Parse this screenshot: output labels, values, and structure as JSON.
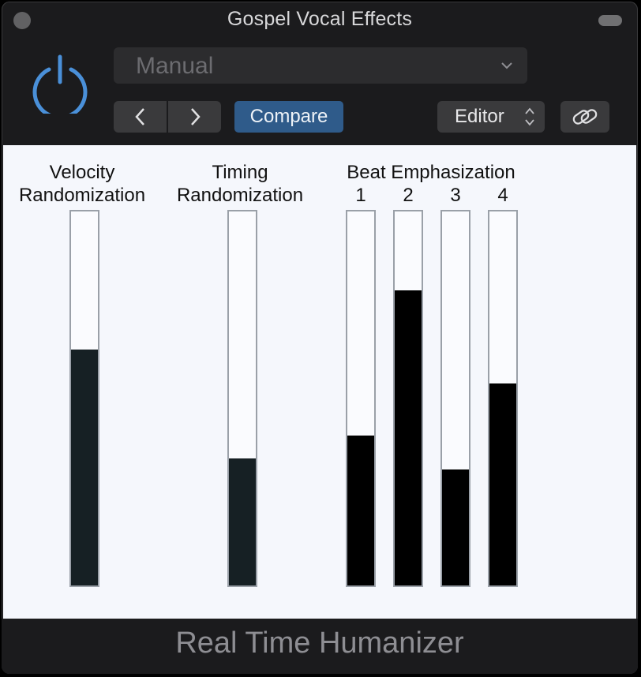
{
  "window": {
    "title": "Gospel Vocal Effects"
  },
  "header": {
    "preset_value": "Manual",
    "compare_label": "Compare",
    "view_value": "Editor",
    "icons": [
      "power-icon",
      "chevron-down-icon",
      "chevron-left-icon",
      "chevron-right-icon",
      "up-down-arrows-icon",
      "link-icon"
    ]
  },
  "controls": {
    "velocity": {
      "label_line1": "Velocity",
      "label_line2": "Randomization",
      "level": 0.63
    },
    "timing": {
      "label_line1": "Timing",
      "label_line2": "Randomization",
      "level": 0.34
    },
    "beat_emphasis": {
      "label": "Beat Emphasization",
      "beats": [
        {
          "label": "1",
          "level": 0.4
        },
        {
          "label": "2",
          "level": 0.79
        },
        {
          "label": "3",
          "level": 0.31
        },
        {
          "label": "4",
          "level": 0.54
        }
      ]
    }
  },
  "footer": {
    "plugin_name": "Real Time Humanizer"
  },
  "colors": {
    "accent": "#2f5b8a",
    "power": "#4a90d9",
    "fill_dark": "#162024",
    "fill_black": "#000000"
  }
}
